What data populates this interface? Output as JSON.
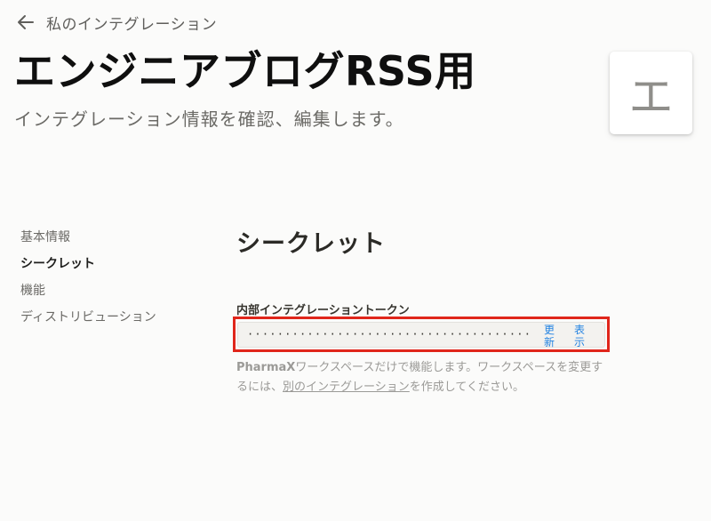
{
  "header": {
    "back_label": "私のインテグレーション",
    "title": "エンジニアブログRSS用",
    "subtitle": "インテグレーション情報を確認、編集します。",
    "avatar_letter": "エ"
  },
  "sidebar": {
    "items": [
      {
        "label": "基本情報",
        "active": false
      },
      {
        "label": "シークレット",
        "active": true
      },
      {
        "label": "機能",
        "active": false
      },
      {
        "label": "ディストリビューション",
        "active": false
      }
    ]
  },
  "secret": {
    "section_title": "シークレット",
    "token_label": "内部インテグレーショントークン",
    "token_masked": "········································",
    "update_label": "更新",
    "show_label": "表示",
    "help_brand": "PharmaX",
    "help_text_1": "ワークスペースだけで機能します。ワークスペースを変更するには、",
    "help_link": "別のインテグレーション",
    "help_text_2": "を作成してください。"
  },
  "colors": {
    "background": "#fbfbfa",
    "accent_link": "#2383e2",
    "highlight_outline": "#e0261b"
  }
}
